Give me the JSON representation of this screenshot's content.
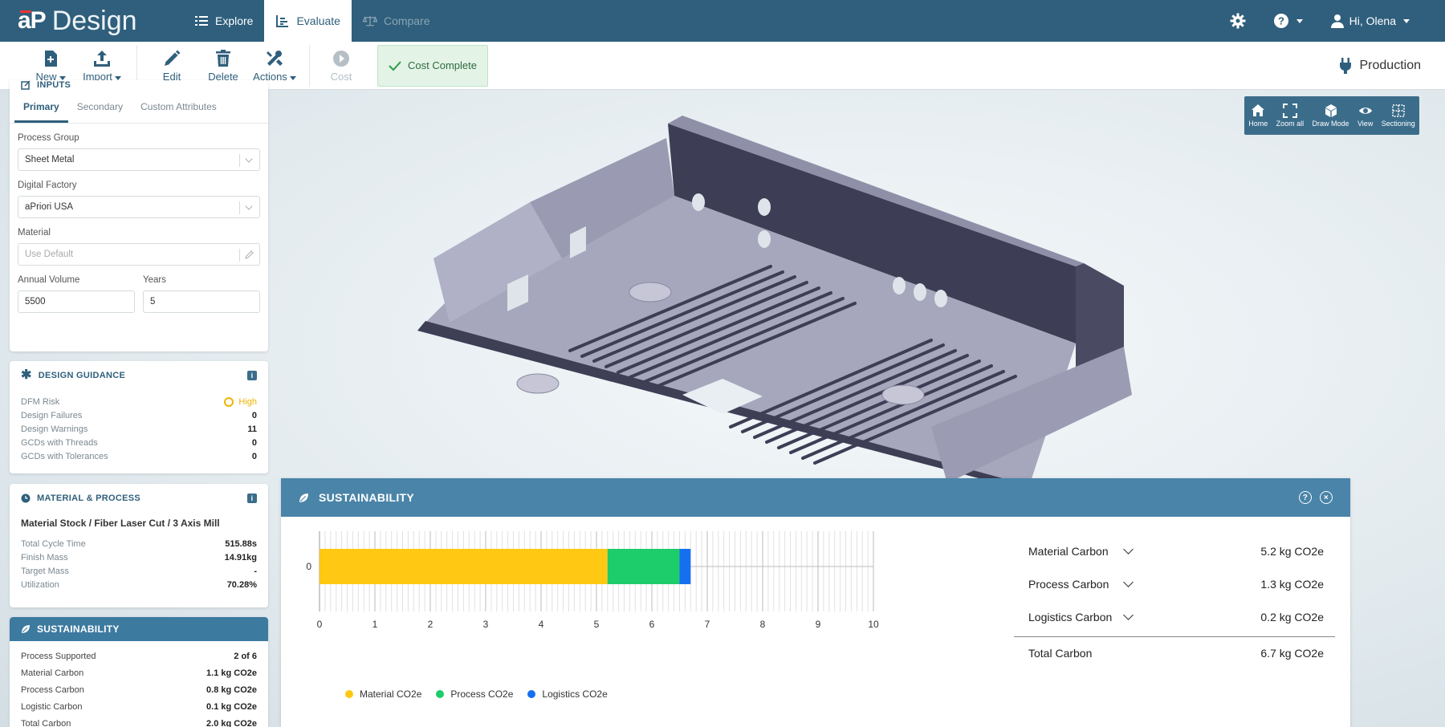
{
  "app": {
    "logo_mark": "aP",
    "logo_text": "Design"
  },
  "nav": {
    "tabs": [
      {
        "label": "Explore"
      },
      {
        "label": "Evaluate"
      },
      {
        "label": "Compare"
      }
    ],
    "user": "Hi, Olena"
  },
  "toolbar": {
    "new": "New",
    "import": "Import",
    "edit": "Edit",
    "delete": "Delete",
    "actions": "Actions",
    "cost": "Cost",
    "cost_status": "Cost Complete",
    "mode": "Production"
  },
  "view_tools": [
    "Home",
    "Zoom all",
    "Draw Mode",
    "View",
    "Sectioning"
  ],
  "inputs": {
    "title": "INPUTS",
    "tabs": [
      "Primary",
      "Secondary",
      "Custom Attributes"
    ],
    "process_group_label": "Process Group",
    "process_group": "Sheet Metal",
    "digital_factory_label": "Digital Factory",
    "digital_factory": "aPriori USA",
    "material_label": "Material",
    "material_placeholder": "Use Default",
    "annual_volume_label": "Annual Volume",
    "annual_volume": "5500",
    "years_label": "Years",
    "years": "5"
  },
  "design_guidance": {
    "title": "DESIGN GUIDANCE",
    "rows": [
      {
        "k": "DFM Risk",
        "v": "High"
      },
      {
        "k": "Design Failures",
        "v": "0"
      },
      {
        "k": "Design Warnings",
        "v": "11"
      },
      {
        "k": "GCDs with Threads",
        "v": "0"
      },
      {
        "k": "GCDs with Tolerances",
        "v": "0"
      }
    ]
  },
  "material_process": {
    "title": "MATERIAL & PROCESS",
    "routing": "Material Stock / Fiber Laser Cut / 3 Axis Mill",
    "rows": [
      {
        "k": "Total Cycle Time",
        "v": "515.88s"
      },
      {
        "k": "Finish Mass",
        "v": "14.91kg"
      },
      {
        "k": "Target Mass",
        "v": "-"
      },
      {
        "k": "Utilization",
        "v": "70.28%"
      }
    ]
  },
  "sustainability_card": {
    "title": "SUSTAINABILITY",
    "rows": [
      {
        "k": "Process Supported",
        "v": "2 of 6"
      },
      {
        "k": "Material Carbon",
        "v": "1.1 kg CO2e"
      },
      {
        "k": "Process Carbon",
        "v": "0.8 kg CO2e"
      },
      {
        "k": "Logistic Carbon",
        "v": "0.1 kg CO2e"
      },
      {
        "k": "Total Carbon",
        "v": "2.0 kg CO2e"
      }
    ]
  },
  "sustainability_dialog": {
    "title": "SUSTAINABILITY",
    "help": "?",
    "close": "×",
    "rows": [
      {
        "label": "Material Carbon",
        "value": "5.2 kg CO2e"
      },
      {
        "label": "Process Carbon",
        "value": "1.3 kg CO2e"
      },
      {
        "label": "Logistics Carbon",
        "value": "0.2 kg CO2e"
      }
    ],
    "total_label": "Total Carbon",
    "total_value": "6.7 kg CO2e"
  },
  "chart_data": {
    "type": "bar",
    "orientation": "horizontal-stacked",
    "categories": [
      "0"
    ],
    "series": [
      {
        "name": "Material CO2e",
        "values": [
          5.2
        ],
        "color": "#ffc812"
      },
      {
        "name": "Process CO2e",
        "values": [
          1.3
        ],
        "color": "#1dcc6b"
      },
      {
        "name": "Logistics CO2e",
        "values": [
          0.2
        ],
        "color": "#1570f0"
      }
    ],
    "xlim": [
      0,
      10
    ],
    "xticks": [
      "0",
      "1",
      "2",
      "3",
      "4",
      "5",
      "6",
      "7",
      "8",
      "9",
      "10"
    ],
    "legend": "bottom"
  }
}
